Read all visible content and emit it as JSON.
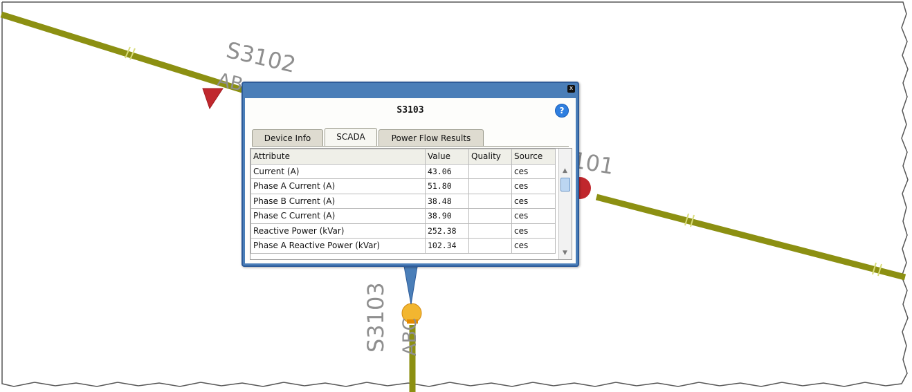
{
  "map": {
    "labels": {
      "s3102": "S3102",
      "s3102_sub": "AB",
      "s3101": "S3101",
      "s3103": "S3103",
      "s3103_sub": "ABC"
    },
    "colors": {
      "feeder_line": "#8c9012",
      "device_marker": "#c0272d",
      "selected_device": "#f2b630",
      "label": "#8f8f8f"
    }
  },
  "popup": {
    "title": "S3103",
    "close_label": "x",
    "help_label": "?",
    "tabs": [
      {
        "label": "Device Info",
        "active": false
      },
      {
        "label": "SCADA",
        "active": true
      },
      {
        "label": "Power Flow Results",
        "active": false
      }
    ],
    "table": {
      "columns": [
        "Attribute",
        "Value",
        "Quality",
        "Source"
      ],
      "rows": [
        {
          "attribute": "Current (A)",
          "value": "43.06",
          "quality": "",
          "source": "ces"
        },
        {
          "attribute": "Phase A Current (A)",
          "value": "51.80",
          "quality": "",
          "source": "ces"
        },
        {
          "attribute": "Phase B Current (A)",
          "value": "38.48",
          "quality": "",
          "source": "ces"
        },
        {
          "attribute": "Phase C Current (A)",
          "value": "38.90",
          "quality": "",
          "source": "ces"
        },
        {
          "attribute": "Reactive Power (kVar)",
          "value": "252.38",
          "quality": "",
          "source": "ces"
        },
        {
          "attribute": "Phase A Reactive Power (kVar)",
          "value": "102.34",
          "quality": "",
          "source": "ces"
        }
      ]
    }
  }
}
